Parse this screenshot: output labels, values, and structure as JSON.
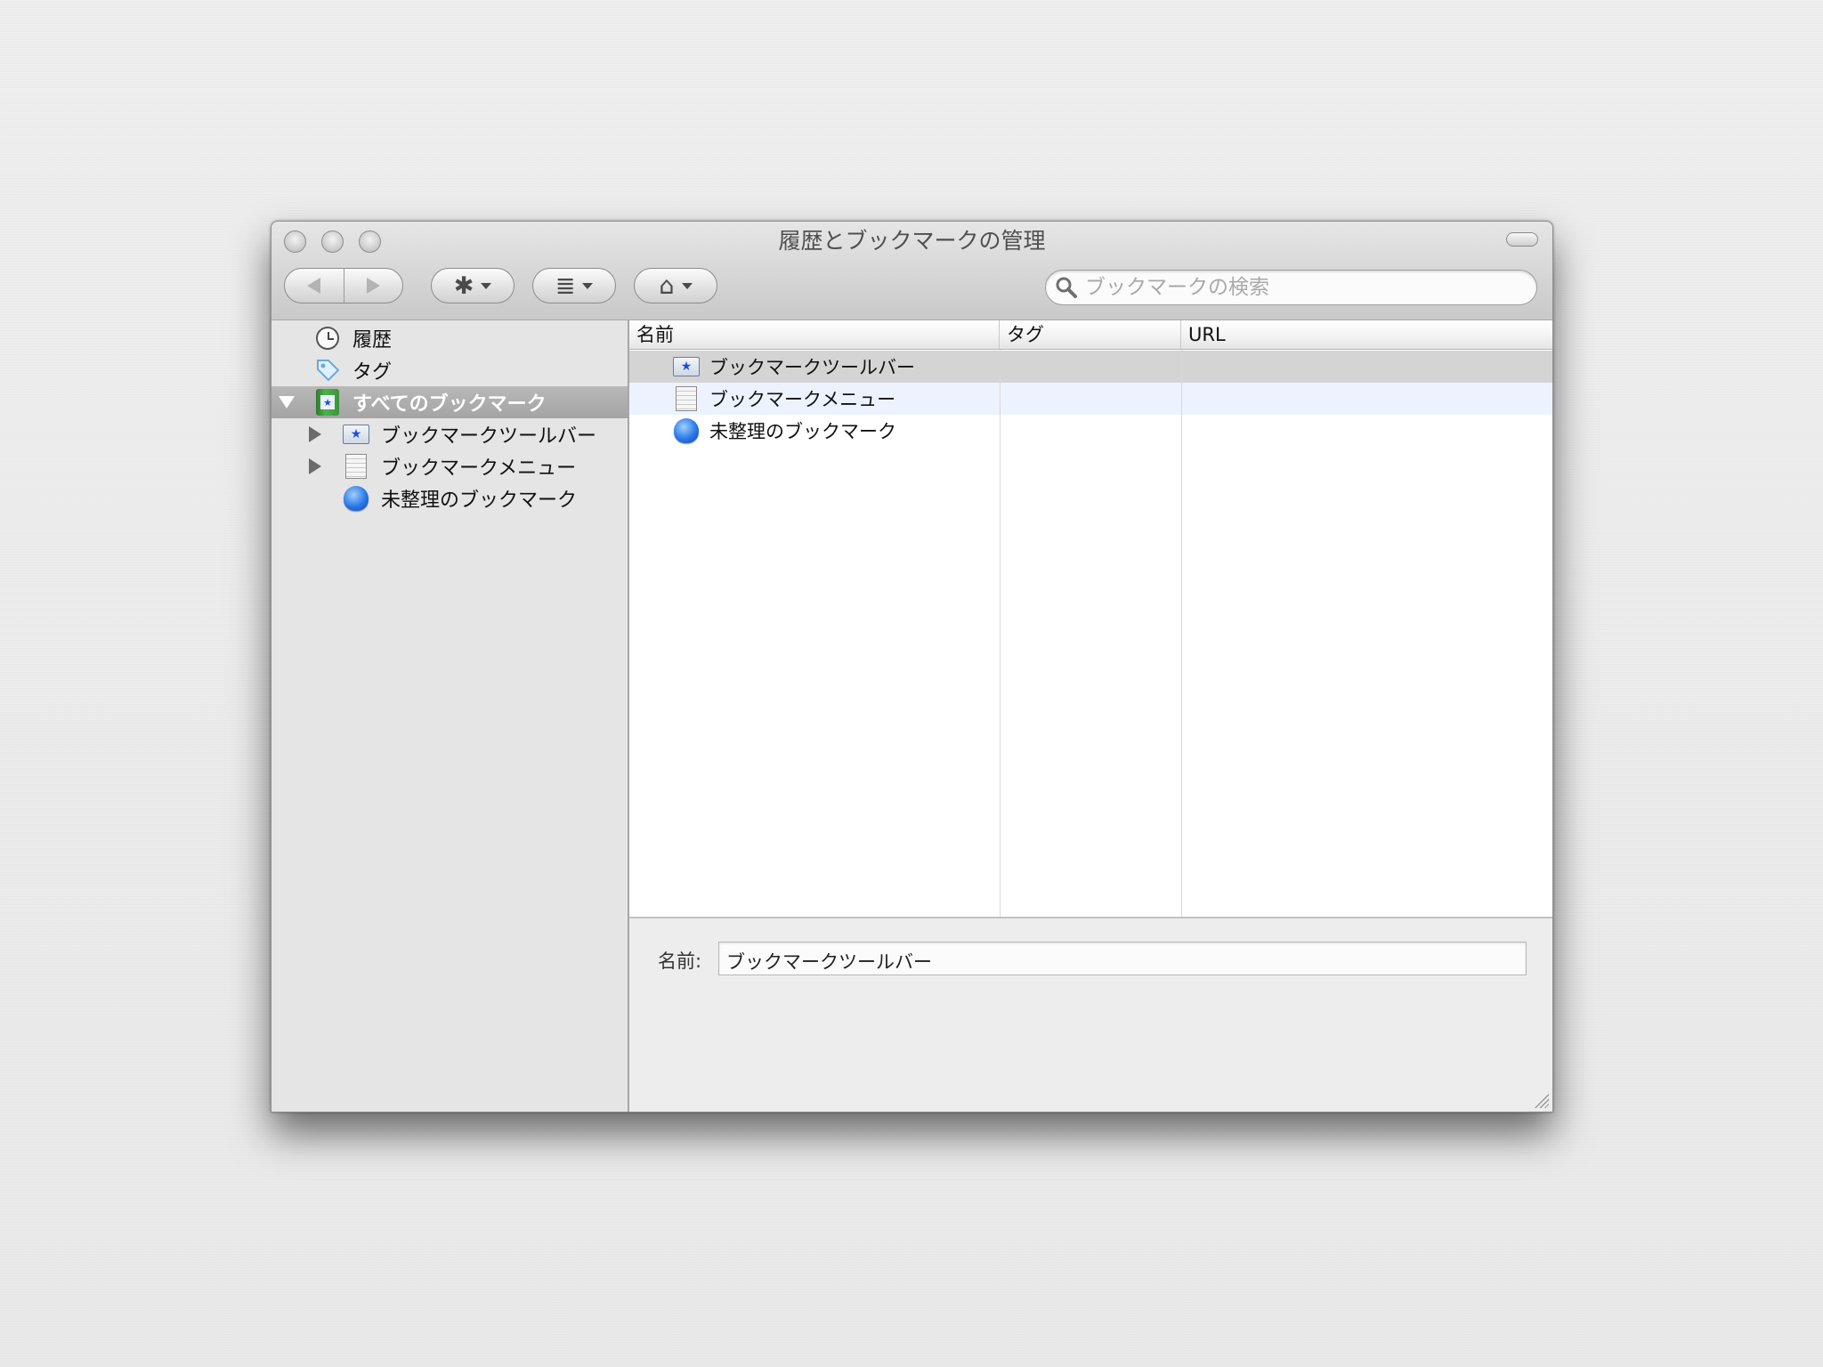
{
  "window": {
    "title": "履歴とブックマークの管理"
  },
  "toolbar": {
    "back": "back-arrow-icon",
    "forward": "forward-arrow-icon",
    "organize_icon": "gear-icon",
    "views_icon": "list-icon",
    "import_icon": "star-house-icon",
    "search_placeholder": "ブックマークの検索"
  },
  "sidebar": {
    "items": [
      {
        "label": "履歴",
        "icon": "clock-icon"
      },
      {
        "label": "タグ",
        "icon": "tag-icon"
      },
      {
        "label": "すべてのブックマーク",
        "icon": "bookmarks-library-icon",
        "selected": true,
        "expanded": true
      },
      {
        "label": "ブックマークツールバー",
        "icon": "bookmark-toolbar-icon"
      },
      {
        "label": "ブックマークメニュー",
        "icon": "bookmark-menu-icon"
      },
      {
        "label": "未整理のブックマーク",
        "icon": "unsorted-bookmarks-icon"
      }
    ]
  },
  "list": {
    "columns": [
      "名前",
      "タグ",
      "URL"
    ],
    "rows": [
      {
        "name": "ブックマークツールバー"
      },
      {
        "name": "ブックマークメニュー"
      },
      {
        "name": "未整理のブックマーク"
      }
    ]
  },
  "details": {
    "name_label": "名前:",
    "name_value": "ブックマークツールバー"
  }
}
